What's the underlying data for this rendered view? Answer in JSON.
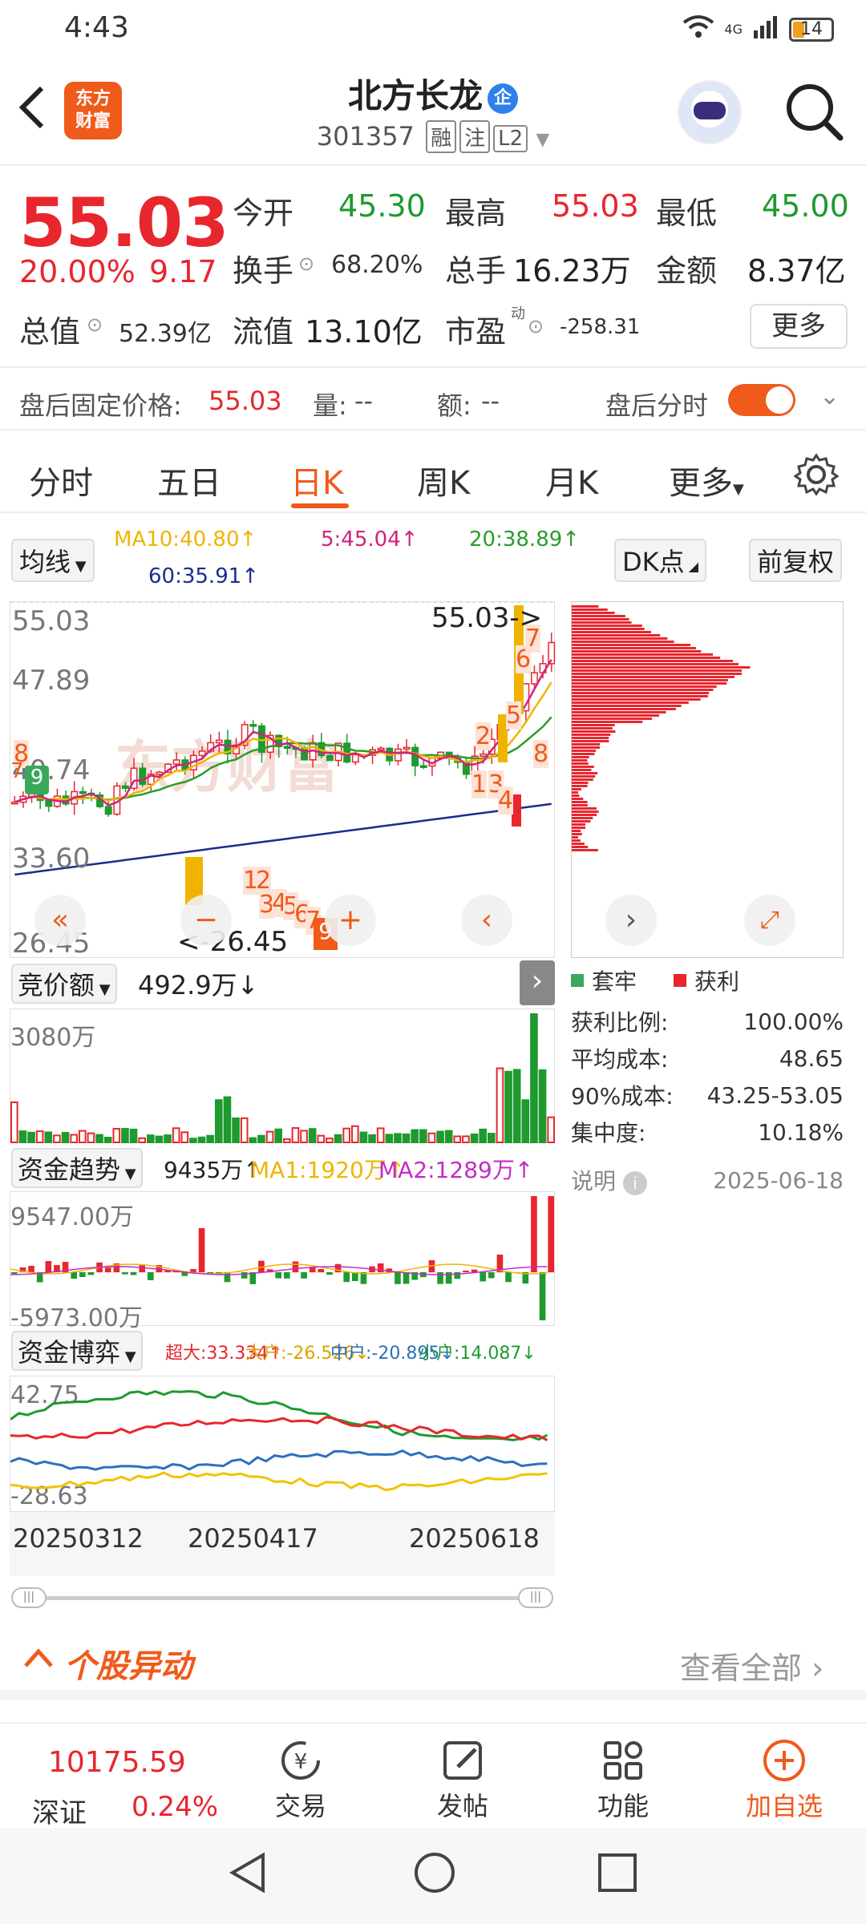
{
  "status_bar": {
    "time": "4:43",
    "signal": "4G",
    "battery": "14"
  },
  "header": {
    "logo_line1": "东方",
    "logo_line2": "财富",
    "stock_name": "北方长龙",
    "name_badge": "企",
    "stock_code": "301357",
    "tags": [
      "融",
      "注",
      "L2"
    ]
  },
  "quote": {
    "price": "55.03",
    "change_pct": "20.00%",
    "change_amt": "9.17",
    "open_label": "今开",
    "open": "45.30",
    "high_label": "最高",
    "high": "55.03",
    "low_label": "最低",
    "low": "45.00",
    "turnover_label": "换手",
    "turnover": "68.20%",
    "volume_label": "总手",
    "volume": "16.23万",
    "amount_label": "金额",
    "amount": "8.37亿",
    "mktcap_label": "总值",
    "mktcap": "52.39亿",
    "float_label": "流值",
    "float_cap": "13.10亿",
    "pe_label": "市盈",
    "pe_sup": "动",
    "pe": "-258.31",
    "more": "更多"
  },
  "after_hours": {
    "label": "盘后固定价格:",
    "price": "55.03",
    "vol_label": "量:",
    "vol": "--",
    "amt_label": "额:",
    "amt": "--",
    "toggle_label": "盘后分时"
  },
  "tabs": [
    "分时",
    "五日",
    "日K",
    "周K",
    "月K",
    "更多"
  ],
  "active_tab": "日K",
  "ma": {
    "select": "均线",
    "ma10": "MA10:40.80↑",
    "ma5": "5:45.04↑",
    "ma20": "20:38.89↑",
    "ma60": "60:35.91↑",
    "dk": "DK点",
    "adjust": "前复权"
  },
  "kline": {
    "y_labels": [
      "55.03",
      "47.89",
      "40.74",
      "33.60",
      "26.45"
    ],
    "max_label": "55.03->",
    "min_label": "<-26.45",
    "watermark": "东方财富",
    "markers": [
      "8",
      "7",
      "9",
      "1",
      "2",
      "3",
      "4",
      "5",
      "6",
      "7",
      "8",
      "1",
      "2",
      "3",
      "4",
      "5",
      "6",
      "7",
      "9"
    ]
  },
  "auction": {
    "select": "竞价额",
    "value": "492.9万↓",
    "y_label": "3080万"
  },
  "flow": {
    "select": "资金趋势",
    "value": "9435万↑",
    "ma1": "MA1:1920万↑",
    "ma2": "MA2:1289万↑",
    "y_top": "9547.00万",
    "y_bottom": "-5973.00万"
  },
  "game": {
    "select": "资金博弈",
    "xl": "超大:33.334↑",
    "l": "大户:-26.526↓",
    "m": "中户:-20.895↓",
    "s": "小户:14.087↓",
    "y_top": "42.75",
    "y_bottom": "-28.63",
    "dates": [
      "20250312",
      "20250417",
      "20250618"
    ]
  },
  "chips": {
    "legend_trapped": "套牢",
    "legend_profit": "获利",
    "stats": [
      {
        "label": "获利比例:",
        "value": "100.00%"
      },
      {
        "label": "平均成本:",
        "value": "48.65"
      },
      {
        "label": "90%成本:",
        "value": "43.25-53.05"
      },
      {
        "label": "集中度:",
        "value": "10.18%"
      }
    ],
    "note_label": "说明",
    "date": "2025-06-18"
  },
  "movers": {
    "title": "个股异动",
    "view_all": "查看全部"
  },
  "bottom_nav": {
    "index_value": "10175.59",
    "index_name": "深证",
    "index_pct": "0.24%",
    "items": [
      "交易",
      "发帖",
      "功能",
      "加自选"
    ]
  },
  "colors": {
    "up": "#e8262d",
    "down": "#1e9a2f",
    "accent": "#f05a1a",
    "ma5": "#d0237e",
    "ma10": "#f0b400",
    "ma20": "#2a9d2a",
    "ma60": "#1c2c8c"
  }
}
